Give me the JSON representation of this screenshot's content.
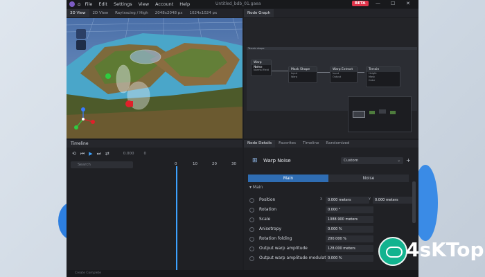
{
  "titlebar": {
    "menu": [
      "File",
      "Edit",
      "Settings",
      "View",
      "Account",
      "Help"
    ],
    "title": "Untitled_bdb_01.gaea",
    "beta": "BETA",
    "min": "—",
    "max": "☐",
    "close": "✕"
  },
  "viewport_tabs": [
    "3D View",
    "2D View",
    "Raytracing / High",
    "2048x2048 px",
    "1024x1024 px"
  ],
  "graph_tabs": [
    "Node Graph"
  ],
  "graph": {
    "frame_title": "Terrain shape",
    "nodes": [
      {
        "title": "Warp Noise",
        "rows": [
          "Noise",
          "Normal Field"
        ]
      },
      {
        "title": "Mask Shape",
        "rows": [
          "Input",
          "Warp"
        ]
      },
      {
        "title": "Warp Extract",
        "rows": [
          "Input",
          "Output"
        ]
      },
      {
        "title": "Terrain",
        "rows": [
          "Height",
          "Mask",
          "Color"
        ]
      }
    ]
  },
  "timeline": {
    "title": "Timeline",
    "controls": [
      "⟲",
      "⏮",
      "▶",
      "⏭",
      "⇄"
    ],
    "time_value": "0.000",
    "frame_value": "0",
    "search_placeholder": "Search",
    "ruler": [
      "0",
      "10",
      "20",
      "30"
    ]
  },
  "details": {
    "tabs": [
      "Node Details",
      "Favorites",
      "Timeline",
      "Randomized"
    ],
    "node_name": "Warp Noise",
    "preset": "Custom",
    "segments": [
      "Main",
      "Noise"
    ],
    "section": "Main",
    "properties": [
      {
        "name": "Position",
        "value": "0.000 meters",
        "value2": "0.000 meters",
        "axis1": "X",
        "axis2": "Y"
      },
      {
        "name": "Rotation",
        "value": "0.000 °"
      },
      {
        "name": "Scale",
        "value": "1088.900 meters"
      },
      {
        "name": "Anisotropy",
        "value": "0.000 %"
      },
      {
        "name": "Rotation folding",
        "value": "200.000 %"
      },
      {
        "name": "Output warp amplitude",
        "value": "128.000 meters"
      },
      {
        "name": "Output warp amplitude modulati",
        "value": "0.000 %"
      }
    ]
  },
  "statusbar": {
    "left": "Create Complete"
  },
  "watermark": {
    "text": "4sKTop"
  },
  "colors": {
    "accent": "#2f6db3",
    "beta": "#e0344a",
    "water": "#4aa6c9",
    "terrain": "#7d6a3c"
  }
}
